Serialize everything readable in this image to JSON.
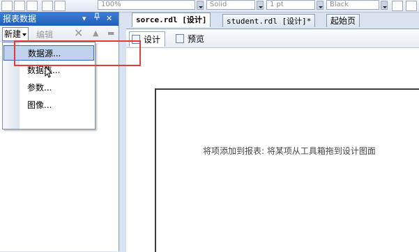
{
  "toolbar": {
    "combo_zoom": "100%",
    "combo_style": "Solid",
    "combo_width": "1 pt",
    "combo_color": "Black"
  },
  "panel": {
    "title": "报表数据",
    "pin_glyph": "▾ ᛫",
    "close_glyph": "✕",
    "new_label": "新建",
    "edit_label": "编辑"
  },
  "new_menu": {
    "items": [
      {
        "label": "数据源...",
        "highlighted": true
      },
      {
        "label": "数据集..."
      },
      {
        "label": "参数..."
      },
      {
        "label": "图像..."
      }
    ]
  },
  "doc_tabs": [
    {
      "label": "sorce.rdl [设计]",
      "active": true
    },
    {
      "label": "student.rdl [设计]*"
    },
    {
      "label": "起始页"
    }
  ],
  "view_tabs": [
    {
      "label": "设计",
      "active": true
    },
    {
      "label": "预览"
    }
  ],
  "design_surface": {
    "hint": "将项添加到报表: 将某项从工具箱拖到设计图面"
  },
  "colors": {
    "title_bar": "#2b6cc4",
    "highlight": "#c1d2ee",
    "annotation_red": "#e23b3b"
  },
  "icons": [
    "close-icon",
    "pin-icon",
    "delete-icon",
    "move-up-icon",
    "move-down-icon",
    "design-icon",
    "preview-icon",
    "mouse-cursor-icon"
  ]
}
